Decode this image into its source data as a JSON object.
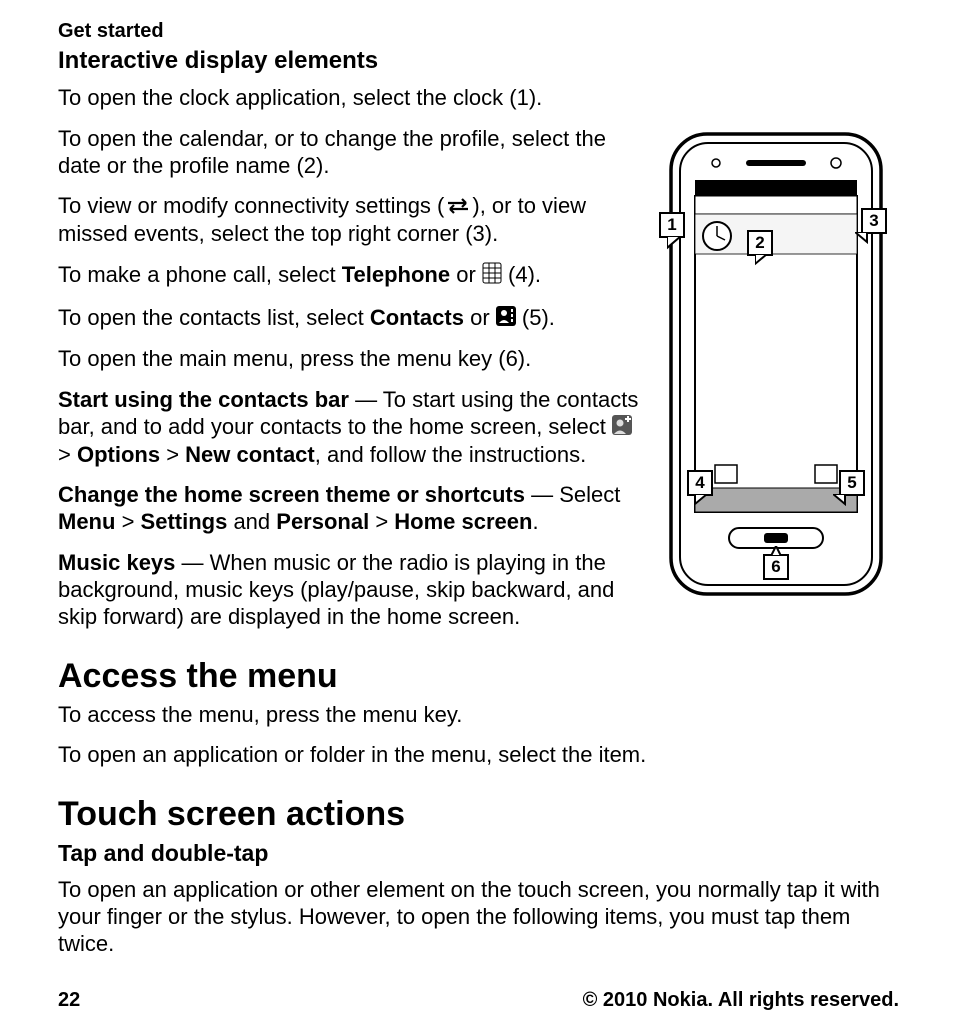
{
  "header": {
    "section": "Get started"
  },
  "subheading1": "Interactive display elements",
  "p1": "To open the clock application, select the clock (1).",
  "p2": "To open the calendar, or to change the profile, select the date or the profile name (2).",
  "p3a": "To view or modify connectivity settings (",
  "p3b": "), or to view missed events, select the top right corner (3).",
  "p4a": "To make a phone call, select ",
  "p4bold": "Telephone",
  "p4b": " or ",
  "p4c": " (4).",
  "p5a": "To open the contacts list, select ",
  "p5bold": "Contacts",
  "p5b": " or ",
  "p5c": " (5).",
  "p6": "To open the main menu, press the menu key (6).",
  "p7bold": "Start using the contacts bar",
  "p7a": " —  To start using the contacts bar, and to add your contacts to the home screen, select ",
  "p7b": " > ",
  "p7opt": "Options",
  "p7c": " > ",
  "p7new": "New contact",
  "p7d": ", and follow the instructions.",
  "p8bold": "Change the home screen theme or shortcuts",
  "p8a": " —  Select ",
  "p8menu": "Menu",
  "p8b": " > ",
  "p8set": "Settings",
  "p8c": " and ",
  "p8pers": "Personal",
  "p8d": " > ",
  "p8home": "Home screen",
  "p8e": ".",
  "p9bold": "Music keys",
  "p9a": " —  When music or the radio is playing in the background, music keys (play/pause, skip backward, and skip forward) are displayed in the home screen.",
  "h2a": "Access the menu",
  "p10": "To access the menu, press the menu key.",
  "p11": "To open an application or folder in the menu, select the item.",
  "h2b": "Touch screen actions",
  "subheading2": "Tap and double-tap",
  "p12": "To open an application or other element on the touch screen, you normally tap it with your finger or the stylus. However, to open the following items, you must tap them twice.",
  "footer": {
    "page": "22",
    "copyright": "© 2010 Nokia. All rights reserved."
  },
  "callouts": {
    "c1": "1",
    "c2": "2",
    "c3": "3",
    "c4": "4",
    "c5": "5",
    "c6": "6"
  }
}
